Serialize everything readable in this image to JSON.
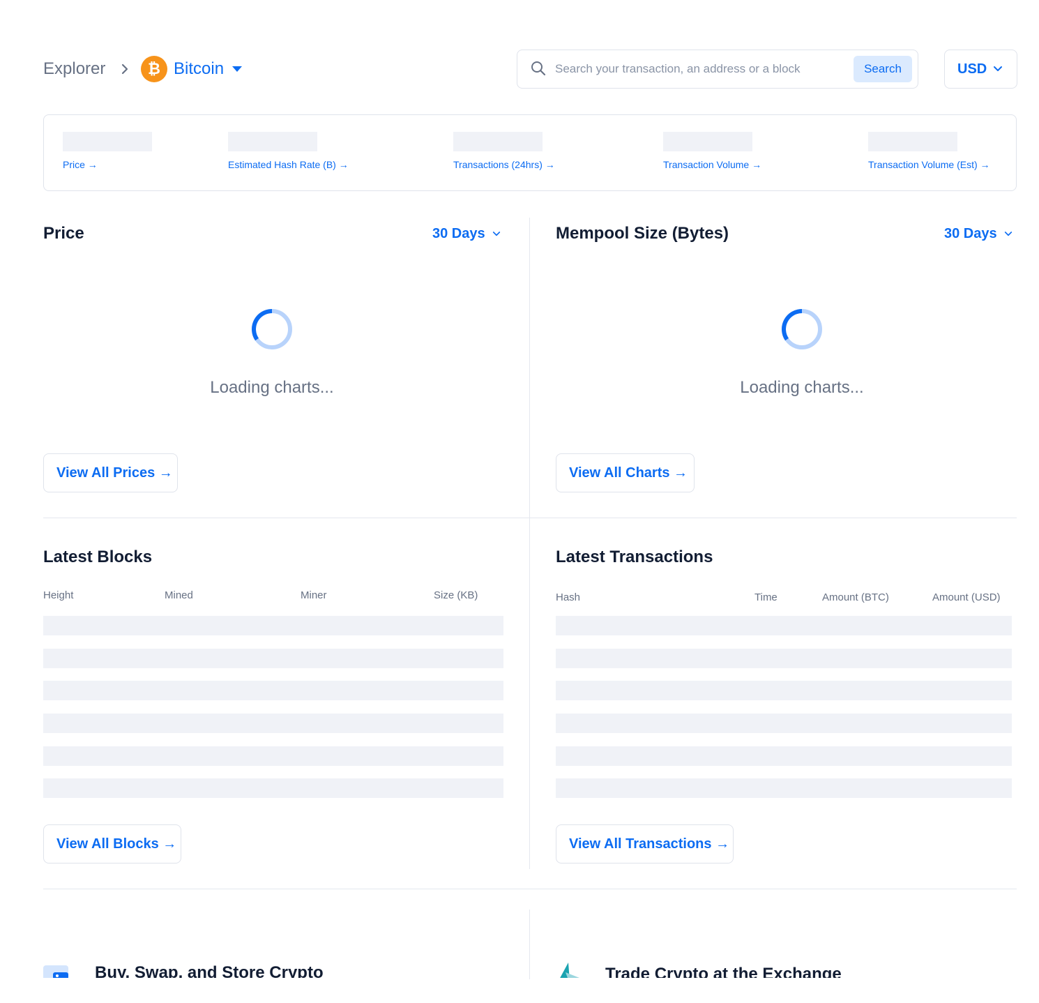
{
  "header": {
    "breadcrumb_root": "Explorer",
    "coin_name": "Bitcoin",
    "coin_symbol_glyph": "₿",
    "search_placeholder": "Search your transaction, an address or a block",
    "search_button": "Search",
    "currency": "USD"
  },
  "stats": [
    {
      "label": "Price →"
    },
    {
      "label": "Estimated Hash Rate (B) →"
    },
    {
      "label": "Transactions (24hrs) →"
    },
    {
      "label": "Transaction Volume →"
    },
    {
      "label": "Transaction Volume (Est) →"
    }
  ],
  "price_panel": {
    "title": "Price",
    "range": "30 Days",
    "loading": "Loading charts...",
    "button": "View All Prices →"
  },
  "mempool_panel": {
    "title": "Mempool Size (Bytes)",
    "range": "30 Days",
    "loading": "Loading charts...",
    "button": "View All Charts →"
  },
  "blocks_panel": {
    "title": "Latest Blocks",
    "columns": [
      "Height",
      "Mined",
      "Miner",
      "Size (KB)"
    ],
    "button": "View All Blocks →"
  },
  "tx_panel": {
    "title": "Latest Transactions",
    "columns": [
      "Hash",
      "Time",
      "Amount (BTC)",
      "Amount (USD)"
    ],
    "button": "View All Transactions →"
  },
  "promos": [
    {
      "title": "Buy, Swap, and Store Crypto",
      "icon": "wallet-icon"
    },
    {
      "title": "Trade Crypto at the Exchange",
      "icon": "exchange-logo-icon"
    }
  ],
  "colors": {
    "accent": "#0c6cf2",
    "bitcoin": "#f7931a",
    "skeleton": "#f0f2f7",
    "border": "#dfe3eb"
  }
}
